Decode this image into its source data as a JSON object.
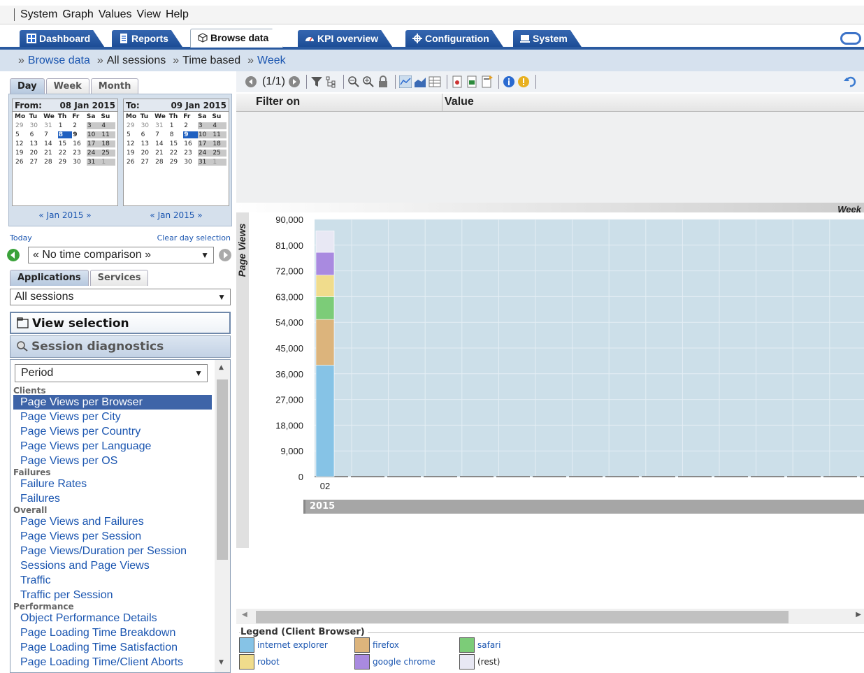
{
  "menu": [
    "System",
    "Graph",
    "Values",
    "View",
    "Help"
  ],
  "tabs": [
    {
      "label": "Dashboard",
      "icon": "dashboard-icon",
      "active": false
    },
    {
      "label": "Reports",
      "icon": "reports-icon",
      "active": false
    },
    {
      "label": "Browse data",
      "icon": "cube-icon",
      "active": true
    },
    {
      "label": "KPI overview",
      "icon": "kpi-icon",
      "active": false
    },
    {
      "label": "Configuration",
      "icon": "gear-icon",
      "active": false
    },
    {
      "label": "System",
      "icon": "computer-icon",
      "active": false
    }
  ],
  "breadcrumb": [
    "Browse data",
    "All sessions",
    "Time based",
    "Week"
  ],
  "period_tabs": [
    "Day",
    "Week",
    "Month"
  ],
  "calendar_from": {
    "label": "From:",
    "date": "08 Jan 2015",
    "nav": "« Jan 2015 »"
  },
  "calendar_to": {
    "label": "To:",
    "date": "09 Jan 2015",
    "nav": "« Jan 2015 »"
  },
  "weekdays": [
    "Mo",
    "Tu",
    "We",
    "Th",
    "Fr",
    "Sa",
    "Su"
  ],
  "calendar_weeks": [
    [
      "29",
      "30",
      "31",
      "1",
      "2",
      "3",
      "4"
    ],
    [
      "5",
      "6",
      "7",
      "8",
      "9",
      "10",
      "11"
    ],
    [
      "12",
      "13",
      "14",
      "15",
      "16",
      "17",
      "18"
    ],
    [
      "19",
      "20",
      "21",
      "22",
      "23",
      "24",
      "25"
    ],
    [
      "26",
      "27",
      "28",
      "29",
      "30",
      "31",
      "1"
    ]
  ],
  "today_link": "Today",
  "clear_link": "Clear day selection",
  "time_comparison": "« No time comparison »",
  "source_tabs": [
    "Applications",
    "Services"
  ],
  "app_select": "All sessions",
  "view_selection": "View selection",
  "session_diagnostics": "Session diagnostics",
  "period_select": "Period",
  "groups": [
    {
      "name": "Clients",
      "items": [
        "Page Views per Browser",
        "Page Views per City",
        "Page Views per Country",
        "Page Views per Language",
        "Page Views per OS"
      ]
    },
    {
      "name": "Failures",
      "items": [
        "Failure Rates",
        "Failures"
      ]
    },
    {
      "name": "Overall",
      "items": [
        "Page Views and Failures",
        "Page Views per Session",
        "Page Views/Duration per Session",
        "Sessions and Page Views",
        "Traffic",
        "Traffic per Session"
      ]
    },
    {
      "name": "Performance",
      "items": [
        "Object Performance Details",
        "Page Loading Time Breakdown",
        "Page Loading Time Satisfaction",
        "Page Loading Time/Client Aborts"
      ]
    }
  ],
  "selected_item": "Page Views per Browser",
  "toolbar": {
    "page_indicator": "(1/1)"
  },
  "filter_table": {
    "col1": "Filter on",
    "col2": "Value"
  },
  "chart_period_label": "Week",
  "year_label": "2015",
  "legend_title": "Legend (Client Browser)",
  "colors": {
    "internet explorer": "#86c3e6",
    "firefox": "#dcb47c",
    "safari": "#7ccc78",
    "robot": "#f0dc8c",
    "google chrome": "#a98ae0",
    "(rest)": "#e8e8f4"
  },
  "chart_data": {
    "type": "bar",
    "stacked": true,
    "categories": [
      "02"
    ],
    "ylabel": "Page Views",
    "ylim": [
      0,
      90000
    ],
    "yticks": [
      0,
      9000,
      18000,
      27000,
      36000,
      45000,
      54000,
      63000,
      72000,
      81000,
      90000
    ],
    "series": [
      {
        "name": "internet explorer",
        "values": [
          39000
        ]
      },
      {
        "name": "firefox",
        "values": [
          16000
        ]
      },
      {
        "name": "safari",
        "values": [
          8000
        ]
      },
      {
        "name": "robot",
        "values": [
          7500
        ]
      },
      {
        "name": "google chrome",
        "values": [
          8000
        ]
      },
      {
        "name": "(rest)",
        "values": [
          7500
        ]
      }
    ]
  }
}
